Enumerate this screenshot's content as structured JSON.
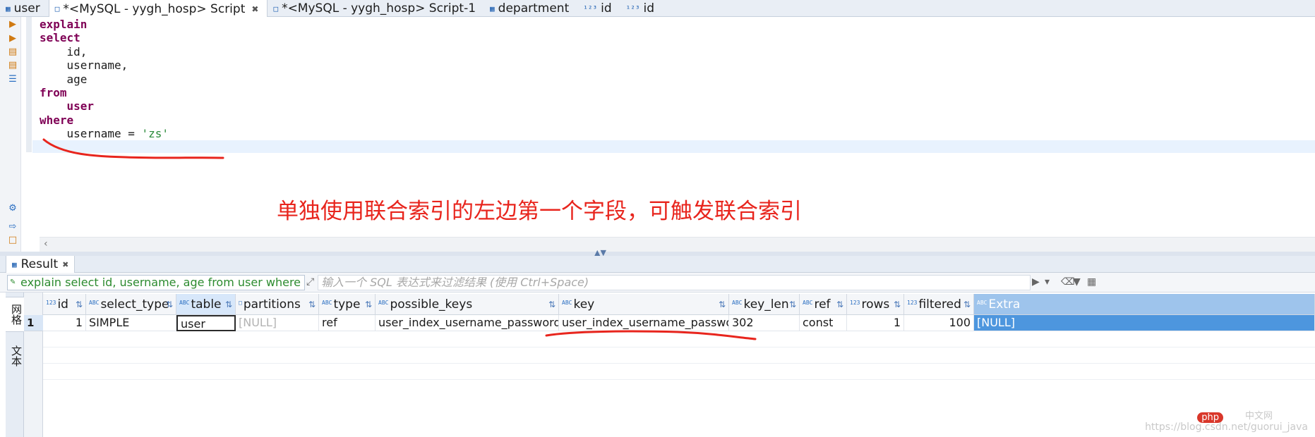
{
  "tabs": [
    {
      "label": "user",
      "icon": "table-icon"
    },
    {
      "label": "*<MySQL - yygh_hosp> Script",
      "icon": "script-icon",
      "active": true
    },
    {
      "label": "*<MySQL - yygh_hosp> Script-1",
      "icon": "script-icon"
    },
    {
      "label": "department",
      "icon": "table-icon"
    },
    {
      "label": "id",
      "icon": "numeric-column-icon"
    },
    {
      "label": "id",
      "icon": "numeric-column-icon"
    }
  ],
  "editor": {
    "lines": [
      {
        "kw": "explain",
        "rest": ""
      },
      {
        "kw": "select",
        "rest": ""
      },
      {
        "kw": "",
        "rest": "    id,"
      },
      {
        "kw": "",
        "rest": "    username,"
      },
      {
        "kw": "",
        "rest": "    age"
      },
      {
        "kw": "from",
        "rest": ""
      },
      {
        "kw": "",
        "rest": "    user"
      },
      {
        "kw": "where",
        "rest": ""
      },
      {
        "kw": "",
        "rest": "    username = ",
        "str": "'zs'"
      }
    ],
    "annotation": "单独使用联合索引的左边第一个字段，可触发联合索引"
  },
  "result": {
    "tab_label": "Result",
    "query_text": "explain select id, username, age from user where userna",
    "filter_placeholder": "输入一个 SQL 表达式来过滤结果 (使用 Ctrl+Space)",
    "side_tabs": {
      "grid": "网格",
      "text": "文本"
    },
    "columns": [
      "id",
      "select_type",
      "table",
      "partitions",
      "type",
      "possible_keys",
      "key",
      "key_len",
      "ref",
      "rows",
      "filtered",
      "Extra"
    ],
    "column_types": [
      "123",
      "ABC",
      "ABC",
      "file",
      "ABC",
      "ABC",
      "ABC",
      "ABC",
      "ABC",
      "123",
      "123",
      "ABC"
    ],
    "rows": [
      {
        "row_number": "1",
        "cells": [
          "1",
          "SIMPLE",
          "user",
          "[NULL]",
          "ref",
          "user_index_username_password",
          "user_index_username_password",
          "302",
          "const",
          "1",
          "100",
          "[NULL]"
        ]
      }
    ]
  },
  "watermark": "https://blog.csdn.net/guorui_java",
  "php_logo": "php",
  "php_site": "中文网",
  "colors": {
    "keyword": "#7f0055",
    "string": "#2a8a3a",
    "annotation": "#e8251d",
    "selection": "#4d96de"
  }
}
